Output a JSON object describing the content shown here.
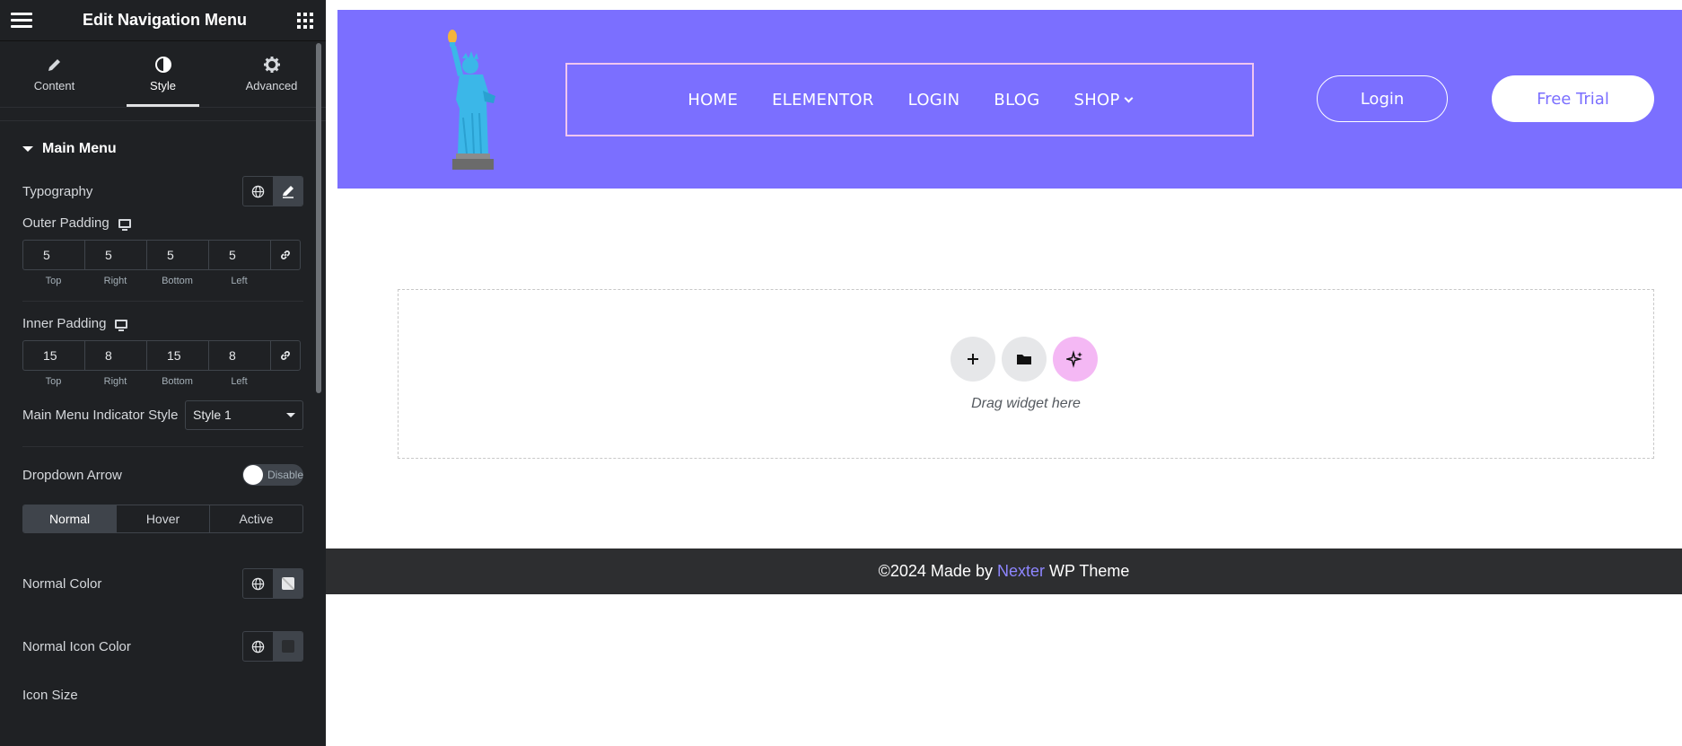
{
  "panel": {
    "title": "Edit Navigation Menu",
    "tabs": [
      {
        "label": "Content",
        "icon": "pencil-icon"
      },
      {
        "label": "Style",
        "icon": "contrast-icon"
      },
      {
        "label": "Advanced",
        "icon": "gear-icon"
      }
    ],
    "section_title": "Main Menu",
    "typography_label": "Typography",
    "outer_padding": {
      "label": "Outer Padding",
      "values": [
        "5",
        "5",
        "5",
        "5"
      ],
      "captions": [
        "Top",
        "Right",
        "Bottom",
        "Left"
      ]
    },
    "inner_padding": {
      "label": "Inner Padding",
      "values": [
        "15",
        "8",
        "15",
        "8"
      ],
      "captions": [
        "Top",
        "Right",
        "Bottom",
        "Left"
      ]
    },
    "indicator": {
      "label": "Main Menu Indicator Style",
      "value": "Style 1"
    },
    "dropdown_arrow": {
      "label": "Dropdown Arrow",
      "toggle_text": "Disable"
    },
    "states": [
      "Normal",
      "Hover",
      "Active"
    ],
    "normal_color_label": "Normal Color",
    "normal_icon_color_label": "Normal Icon Color",
    "icon_size_label": "Icon Size"
  },
  "site": {
    "nav": [
      "HOME",
      "ELEMENTOR",
      "LOGIN",
      "BLOG",
      "SHOP"
    ],
    "login_button": "Login",
    "trial_button": "Free Trial",
    "drop_text": "Drag widget here",
    "footer": {
      "prefix": "©2024 Made by",
      "brand": "Nexter",
      "suffix": "WP Theme"
    },
    "colors": {
      "header_bg": "#7b6fff",
      "nav_border": "#f0c6f0",
      "footer_bg": "#2d2e30",
      "brand": "#8e86ff"
    }
  }
}
